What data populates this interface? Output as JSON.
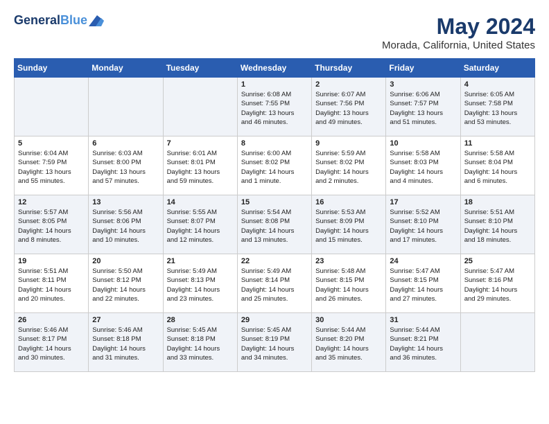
{
  "header": {
    "logo_line1": "General",
    "logo_line2": "Blue",
    "title": "May 2024",
    "subtitle": "Morada, California, United States"
  },
  "days_of_week": [
    "Sunday",
    "Monday",
    "Tuesday",
    "Wednesday",
    "Thursday",
    "Friday",
    "Saturday"
  ],
  "weeks": [
    [
      {
        "day": "",
        "info": ""
      },
      {
        "day": "",
        "info": ""
      },
      {
        "day": "",
        "info": ""
      },
      {
        "day": "1",
        "info": "Sunrise: 6:08 AM\nSunset: 7:55 PM\nDaylight: 13 hours\nand 46 minutes."
      },
      {
        "day": "2",
        "info": "Sunrise: 6:07 AM\nSunset: 7:56 PM\nDaylight: 13 hours\nand 49 minutes."
      },
      {
        "day": "3",
        "info": "Sunrise: 6:06 AM\nSunset: 7:57 PM\nDaylight: 13 hours\nand 51 minutes."
      },
      {
        "day": "4",
        "info": "Sunrise: 6:05 AM\nSunset: 7:58 PM\nDaylight: 13 hours\nand 53 minutes."
      }
    ],
    [
      {
        "day": "5",
        "info": "Sunrise: 6:04 AM\nSunset: 7:59 PM\nDaylight: 13 hours\nand 55 minutes."
      },
      {
        "day": "6",
        "info": "Sunrise: 6:03 AM\nSunset: 8:00 PM\nDaylight: 13 hours\nand 57 minutes."
      },
      {
        "day": "7",
        "info": "Sunrise: 6:01 AM\nSunset: 8:01 PM\nDaylight: 13 hours\nand 59 minutes."
      },
      {
        "day": "8",
        "info": "Sunrise: 6:00 AM\nSunset: 8:02 PM\nDaylight: 14 hours\nand 1 minute."
      },
      {
        "day": "9",
        "info": "Sunrise: 5:59 AM\nSunset: 8:02 PM\nDaylight: 14 hours\nand 2 minutes."
      },
      {
        "day": "10",
        "info": "Sunrise: 5:58 AM\nSunset: 8:03 PM\nDaylight: 14 hours\nand 4 minutes."
      },
      {
        "day": "11",
        "info": "Sunrise: 5:58 AM\nSunset: 8:04 PM\nDaylight: 14 hours\nand 6 minutes."
      }
    ],
    [
      {
        "day": "12",
        "info": "Sunrise: 5:57 AM\nSunset: 8:05 PM\nDaylight: 14 hours\nand 8 minutes."
      },
      {
        "day": "13",
        "info": "Sunrise: 5:56 AM\nSunset: 8:06 PM\nDaylight: 14 hours\nand 10 minutes."
      },
      {
        "day": "14",
        "info": "Sunrise: 5:55 AM\nSunset: 8:07 PM\nDaylight: 14 hours\nand 12 minutes."
      },
      {
        "day": "15",
        "info": "Sunrise: 5:54 AM\nSunset: 8:08 PM\nDaylight: 14 hours\nand 13 minutes."
      },
      {
        "day": "16",
        "info": "Sunrise: 5:53 AM\nSunset: 8:09 PM\nDaylight: 14 hours\nand 15 minutes."
      },
      {
        "day": "17",
        "info": "Sunrise: 5:52 AM\nSunset: 8:10 PM\nDaylight: 14 hours\nand 17 minutes."
      },
      {
        "day": "18",
        "info": "Sunrise: 5:51 AM\nSunset: 8:10 PM\nDaylight: 14 hours\nand 18 minutes."
      }
    ],
    [
      {
        "day": "19",
        "info": "Sunrise: 5:51 AM\nSunset: 8:11 PM\nDaylight: 14 hours\nand 20 minutes."
      },
      {
        "day": "20",
        "info": "Sunrise: 5:50 AM\nSunset: 8:12 PM\nDaylight: 14 hours\nand 22 minutes."
      },
      {
        "day": "21",
        "info": "Sunrise: 5:49 AM\nSunset: 8:13 PM\nDaylight: 14 hours\nand 23 minutes."
      },
      {
        "day": "22",
        "info": "Sunrise: 5:49 AM\nSunset: 8:14 PM\nDaylight: 14 hours\nand 25 minutes."
      },
      {
        "day": "23",
        "info": "Sunrise: 5:48 AM\nSunset: 8:15 PM\nDaylight: 14 hours\nand 26 minutes."
      },
      {
        "day": "24",
        "info": "Sunrise: 5:47 AM\nSunset: 8:15 PM\nDaylight: 14 hours\nand 27 minutes."
      },
      {
        "day": "25",
        "info": "Sunrise: 5:47 AM\nSunset: 8:16 PM\nDaylight: 14 hours\nand 29 minutes."
      }
    ],
    [
      {
        "day": "26",
        "info": "Sunrise: 5:46 AM\nSunset: 8:17 PM\nDaylight: 14 hours\nand 30 minutes."
      },
      {
        "day": "27",
        "info": "Sunrise: 5:46 AM\nSunset: 8:18 PM\nDaylight: 14 hours\nand 31 minutes."
      },
      {
        "day": "28",
        "info": "Sunrise: 5:45 AM\nSunset: 8:18 PM\nDaylight: 14 hours\nand 33 minutes."
      },
      {
        "day": "29",
        "info": "Sunrise: 5:45 AM\nSunset: 8:19 PM\nDaylight: 14 hours\nand 34 minutes."
      },
      {
        "day": "30",
        "info": "Sunrise: 5:44 AM\nSunset: 8:20 PM\nDaylight: 14 hours\nand 35 minutes."
      },
      {
        "day": "31",
        "info": "Sunrise: 5:44 AM\nSunset: 8:21 PM\nDaylight: 14 hours\nand 36 minutes."
      },
      {
        "day": "",
        "info": ""
      }
    ]
  ]
}
